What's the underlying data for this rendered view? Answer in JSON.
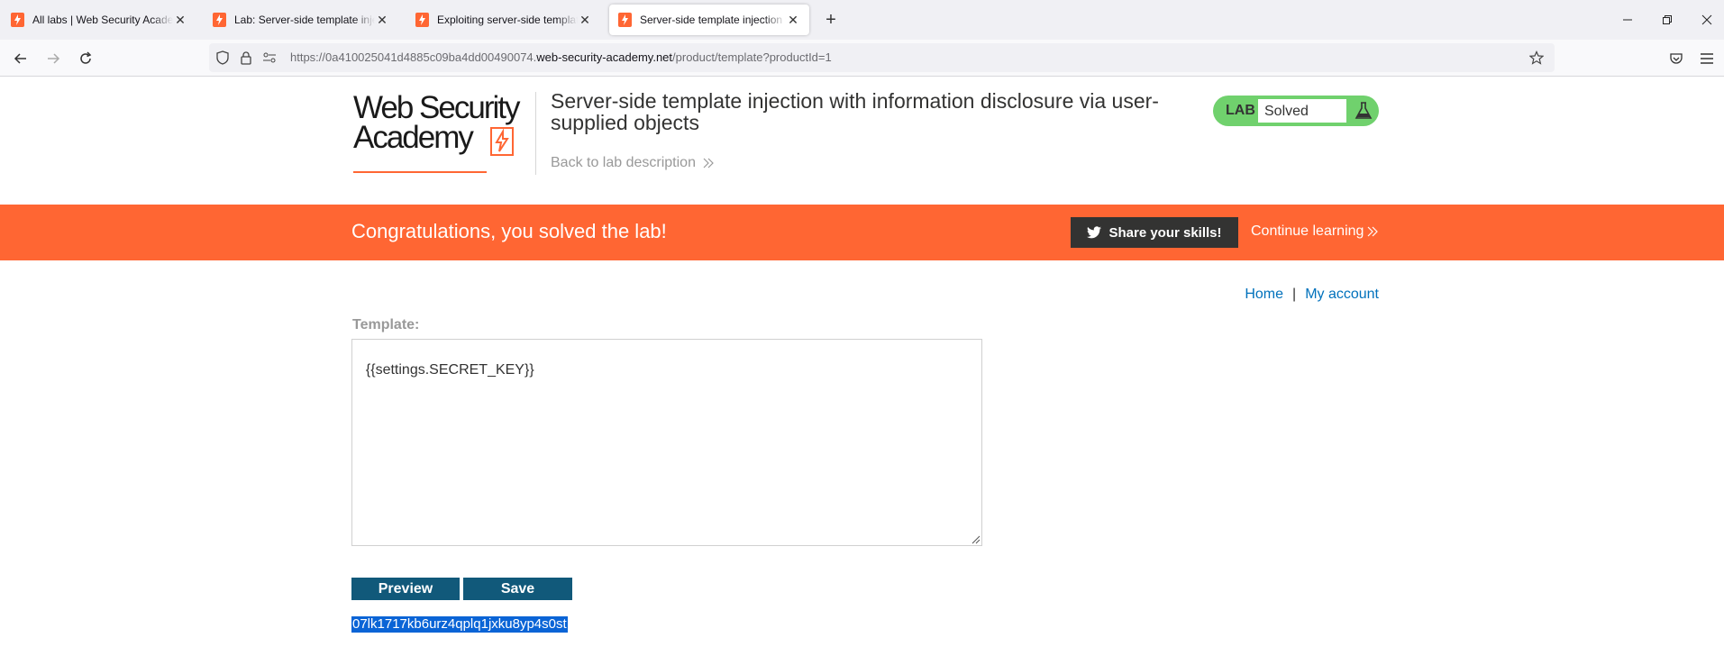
{
  "browser": {
    "tabs": [
      {
        "title": "All labs | Web Security Academy",
        "active": false
      },
      {
        "title": "Lab: Server-side template injection",
        "active": false
      },
      {
        "title": "Exploiting server-side template injection",
        "active": false
      },
      {
        "title": "Server-side template injection with",
        "active": true
      }
    ],
    "url_prefix": "https://0a410025041d4885c09ba4dd00490074.",
    "url_domain": "web-security-academy.net",
    "url_path": "/product/template?productId=1"
  },
  "header": {
    "logo_line1": "Web Security",
    "logo_line2": "Academy",
    "lab_title": "Server-side template injection with information disclosure via user-supplied objects",
    "back_link": "Back to lab description",
    "lab_tag": "LAB",
    "lab_status": "Solved"
  },
  "banner": {
    "congrats": "Congratulations, you solved the lab!",
    "share": "Share your skills!",
    "continue": "Continue learning"
  },
  "nav": {
    "home": "Home",
    "separator": "|",
    "account": "My account"
  },
  "editor": {
    "label": "Template:",
    "template_value": "{{settings.SECRET_KEY}}",
    "preview_label": "Preview",
    "save_label": "Save",
    "output": "07lk1717kb6urz4qplq1jxku8yp4s0st"
  },
  "colors": {
    "brand_orange": "#ff6633",
    "lab_green": "#70d16d",
    "button_blue": "#11597a",
    "link_blue": "#0071bc"
  }
}
